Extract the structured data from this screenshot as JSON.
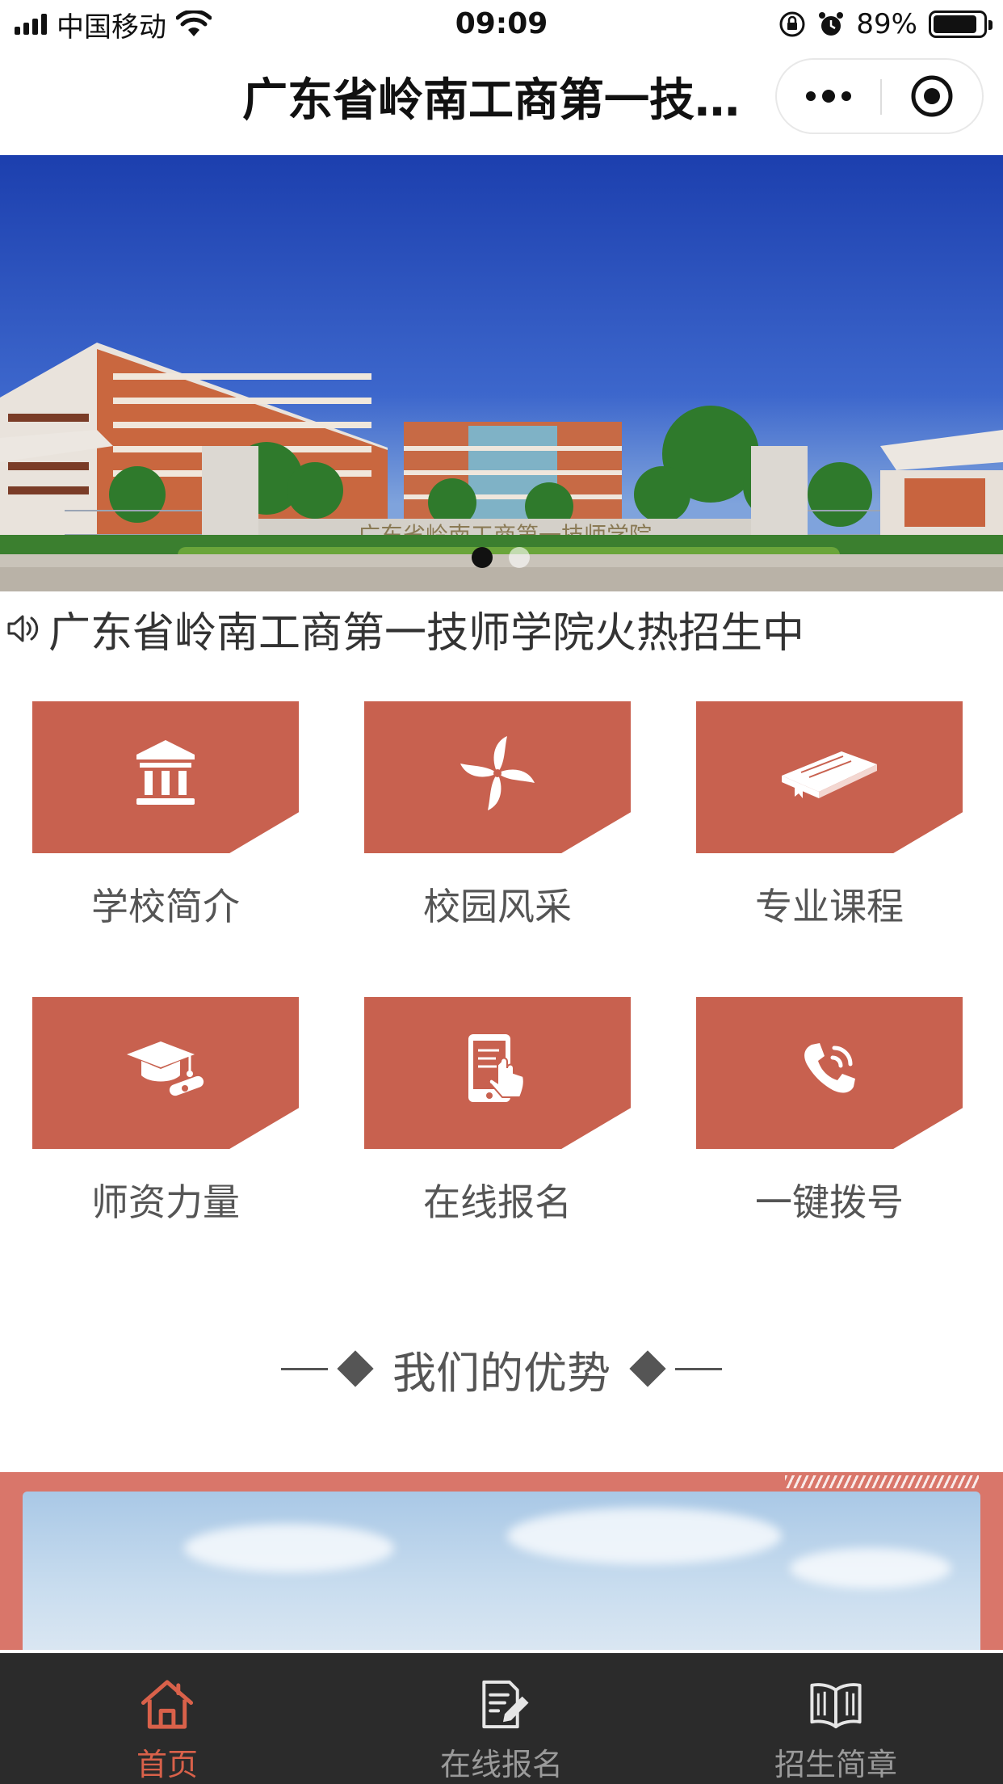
{
  "status_bar": {
    "carrier": "中国移动",
    "time": "09:09",
    "battery": "89%",
    "battery_level": 0.89
  },
  "nav": {
    "title": "广东省岭南工商第一技…",
    "more_icon": "more-dots-icon",
    "close_icon": "target-close-icon"
  },
  "banner": {
    "sign_text": "广东省岭南工商第一技师学院",
    "slide_count": 2,
    "active_slide": 1
  },
  "notice": {
    "icon": "speaker-icon",
    "text": "广东省岭南工商第一技师学院火热招生中"
  },
  "grid": {
    "tile_color": "#c8614f",
    "items": [
      {
        "label": "学校简介",
        "icon": "school-building-icon"
      },
      {
        "label": "校园风采",
        "icon": "pinwheel-icon"
      },
      {
        "label": "专业课程",
        "icon": "book-icon"
      },
      {
        "label": "师资力量",
        "icon": "graduation-cap-icon"
      },
      {
        "label": "在线报名",
        "icon": "tablet-tap-icon"
      },
      {
        "label": "一键拨号",
        "icon": "phone-call-icon"
      }
    ]
  },
  "section": {
    "title": "我们的优势"
  },
  "tab_bar": {
    "active_color": "#d9614a",
    "inactive_color": "#9a9a9a",
    "tabs": [
      {
        "label": "首页",
        "icon": "home-icon",
        "active": true
      },
      {
        "label": "在线报名",
        "icon": "edit-document-icon",
        "active": false
      },
      {
        "label": "招生简章",
        "icon": "open-book-icon",
        "active": false
      }
    ]
  }
}
